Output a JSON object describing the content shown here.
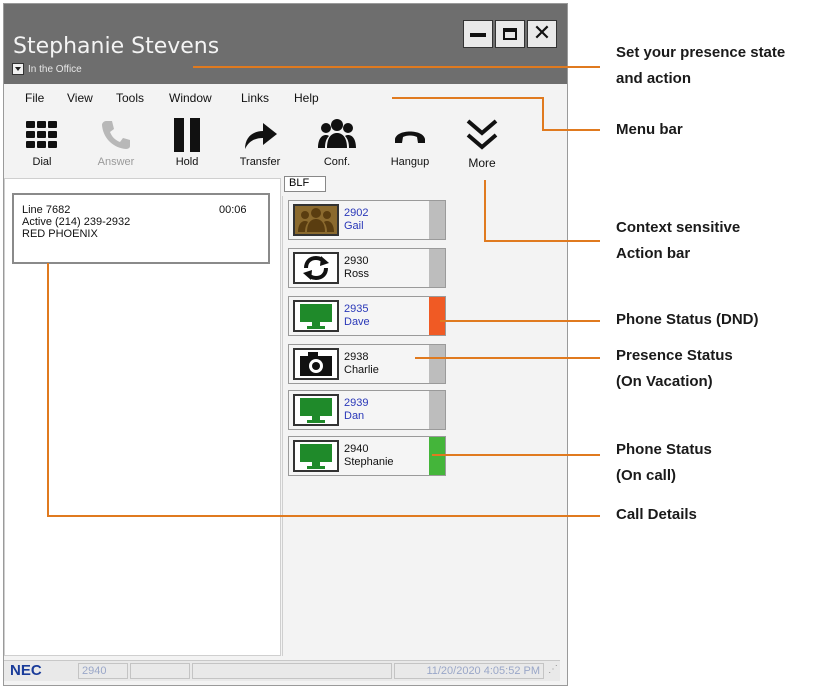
{
  "window": {
    "title": "Stephanie Stevens",
    "presence": "In the Office"
  },
  "menu": [
    "File",
    "View",
    "Tools",
    "Window",
    "Links",
    "Help"
  ],
  "toolbar": {
    "dial": "Dial",
    "answer": "Answer",
    "hold": "Hold",
    "transfer": "Transfer",
    "conf": "Conf.",
    "hangup": "Hangup",
    "more": "More"
  },
  "call": {
    "line": "Line 7682",
    "time": "00:06",
    "status": "Active (214) 239-2932",
    "name": "RED PHOENIX"
  },
  "blf": {
    "tab": "BLF",
    "entries": [
      {
        "ext": "2902",
        "name": "Gail",
        "icon": "group-icon",
        "status_color": "#bdbdbd"
      },
      {
        "ext": "2930",
        "name": "Ross",
        "icon": "refresh-icon",
        "status_color": "#bdbdbd"
      },
      {
        "ext": "2935",
        "name": "Dave",
        "icon": "monitor-icon",
        "status_color": "#f05a24"
      },
      {
        "ext": "2938",
        "name": "Charlie",
        "icon": "camera-icon",
        "status_color": "#bdbdbd"
      },
      {
        "ext": "2939",
        "name": "Dan",
        "icon": "monitor-icon",
        "status_color": "#bdbdbd"
      },
      {
        "ext": "2940",
        "name": "Stephanie",
        "icon": "monitor-icon",
        "status_color": "#44b53a"
      }
    ]
  },
  "statusbar": {
    "brand": "NEC",
    "ext": "2940",
    "datetime": "11/20/2020 4:05:52 PM"
  },
  "annotations": {
    "presence": [
      "Set your presence state",
      "and action"
    ],
    "menu": "Menu bar",
    "action": [
      "Context sensitive",
      "Action bar"
    ],
    "dnd": "Phone Status (DND)",
    "vacation": [
      "Presence Status",
      "(On Vacation)"
    ],
    "oncall": [
      "Phone Status",
      "(On call)"
    ],
    "details": "Call Details"
  }
}
